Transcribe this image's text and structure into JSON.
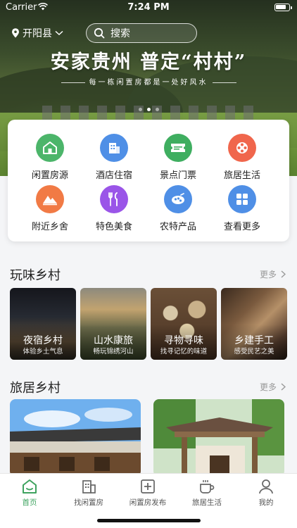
{
  "status_bar": {
    "carrier": "Carrier",
    "time": "7:24 PM"
  },
  "header": {
    "location": "开阳县",
    "search_placeholder": "搜索"
  },
  "banner": {
    "slogan": "安家贵州  普定“村村”",
    "subtitle": "每一栋闲置房都是一处好风水",
    "page_count": 3,
    "active_index": 1
  },
  "categories": [
    {
      "label": "闲置房源",
      "icon": "house-icon",
      "color": "#4cb56a"
    },
    {
      "label": "酒店住宿",
      "icon": "building-icon",
      "color": "#4f8fe6"
    },
    {
      "label": "景点门票",
      "icon": "ticket-icon",
      "color": "#3fae60"
    },
    {
      "label": "旅居生活",
      "icon": "film-reel-icon",
      "color": "#f0664c"
    },
    {
      "label": "附近乡舍",
      "icon": "mountain-icon",
      "color": "#f17a45"
    },
    {
      "label": "特色美食",
      "icon": "fork-knife-icon",
      "color": "#9a55e8"
    },
    {
      "label": "农特产品",
      "icon": "produce-icon",
      "color": "#4f8fe6"
    },
    {
      "label": "查看更多",
      "icon": "grid-icon",
      "color": "#4f8fe6"
    }
  ],
  "section_fun": {
    "title": "玩味乡村",
    "more": "更多",
    "items": [
      {
        "title": "夜宿乡村",
        "subtitle": "体验乡土气息"
      },
      {
        "title": "山水康旅",
        "subtitle": "畅玩锦绣河山"
      },
      {
        "title": "寻物寻味",
        "subtitle": "找寻记忆的味道"
      },
      {
        "title": "乡建手工",
        "subtitle": "感受民艺之美"
      }
    ]
  },
  "section_stay": {
    "title": "旅居乡村",
    "more": "更多"
  },
  "tabbar": [
    {
      "label": "首页",
      "icon": "home-icon",
      "active": true
    },
    {
      "label": "找闲置房",
      "icon": "building-icon",
      "active": false
    },
    {
      "label": "闲置房发布",
      "icon": "add-square-icon",
      "active": false
    },
    {
      "label": "旅居生活",
      "icon": "coffee-cup-icon",
      "active": false
    },
    {
      "label": "我的",
      "icon": "user-icon",
      "active": false
    }
  ],
  "colors": {
    "accent": "#3ea35f",
    "background": "#f4f5f7"
  }
}
